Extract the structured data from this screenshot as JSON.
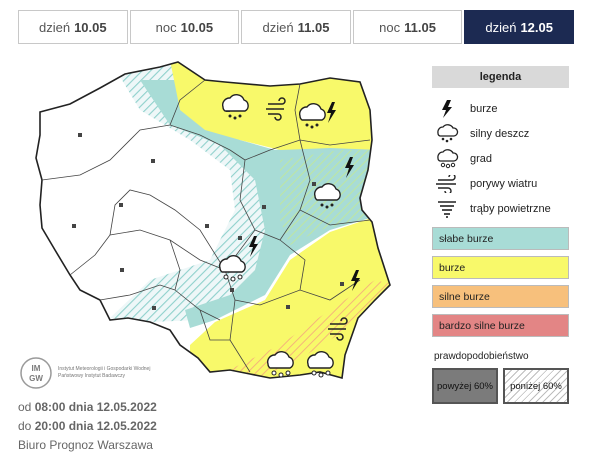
{
  "tabs": [
    {
      "prefix": "dzień",
      "date": "10.05",
      "active": false
    },
    {
      "prefix": "noc",
      "date": "10.05",
      "active": false
    },
    {
      "prefix": "dzień",
      "date": "11.05",
      "active": false
    },
    {
      "prefix": "noc",
      "date": "11.05",
      "active": false
    },
    {
      "prefix": "dzień",
      "date": "12.05",
      "active": true
    }
  ],
  "legend": {
    "title": "legenda",
    "icons": [
      {
        "icon": "lightning-icon",
        "label": "burze"
      },
      {
        "icon": "heavy-rain-icon",
        "label": "silny deszcz"
      },
      {
        "icon": "hail-icon",
        "label": "grad"
      },
      {
        "icon": "wind-gust-icon",
        "label": "porywy wiatru"
      },
      {
        "icon": "tornado-icon",
        "label": "trąby powietrzne"
      }
    ],
    "categories": [
      {
        "label": "słabe burze",
        "color": "#a8dcd6"
      },
      {
        "label": "burze",
        "color": "#f8f96a"
      },
      {
        "label": "silne burze",
        "color": "#f7c07c"
      },
      {
        "label": "bardzo silne burze",
        "color": "#e38585"
      }
    ],
    "probability_title": "prawdopodobieństwo",
    "probability_high": "powyżej 60%",
    "probability_low": "poniżej 60%"
  },
  "logo": {
    "abbr_top": "IM",
    "abbr_bottom": "GW",
    "text": "Instytut Meteorologii i Gospodarki Wodnej Państwowy Instytut Badawczy"
  },
  "validity": {
    "from_prefix": "od",
    "from_time": "08:00 dnia 12.05.2022",
    "to_prefix": "do",
    "to_time": "20:00 dnia 12.05.2022",
    "office": "Biuro Prognoz Warszawa"
  },
  "colors": {
    "active_tab": "#1c2a52",
    "weak": "#a8dcd6",
    "moderate": "#f8f96a",
    "strong": "#f7c07c",
    "very_strong": "#e38585"
  }
}
